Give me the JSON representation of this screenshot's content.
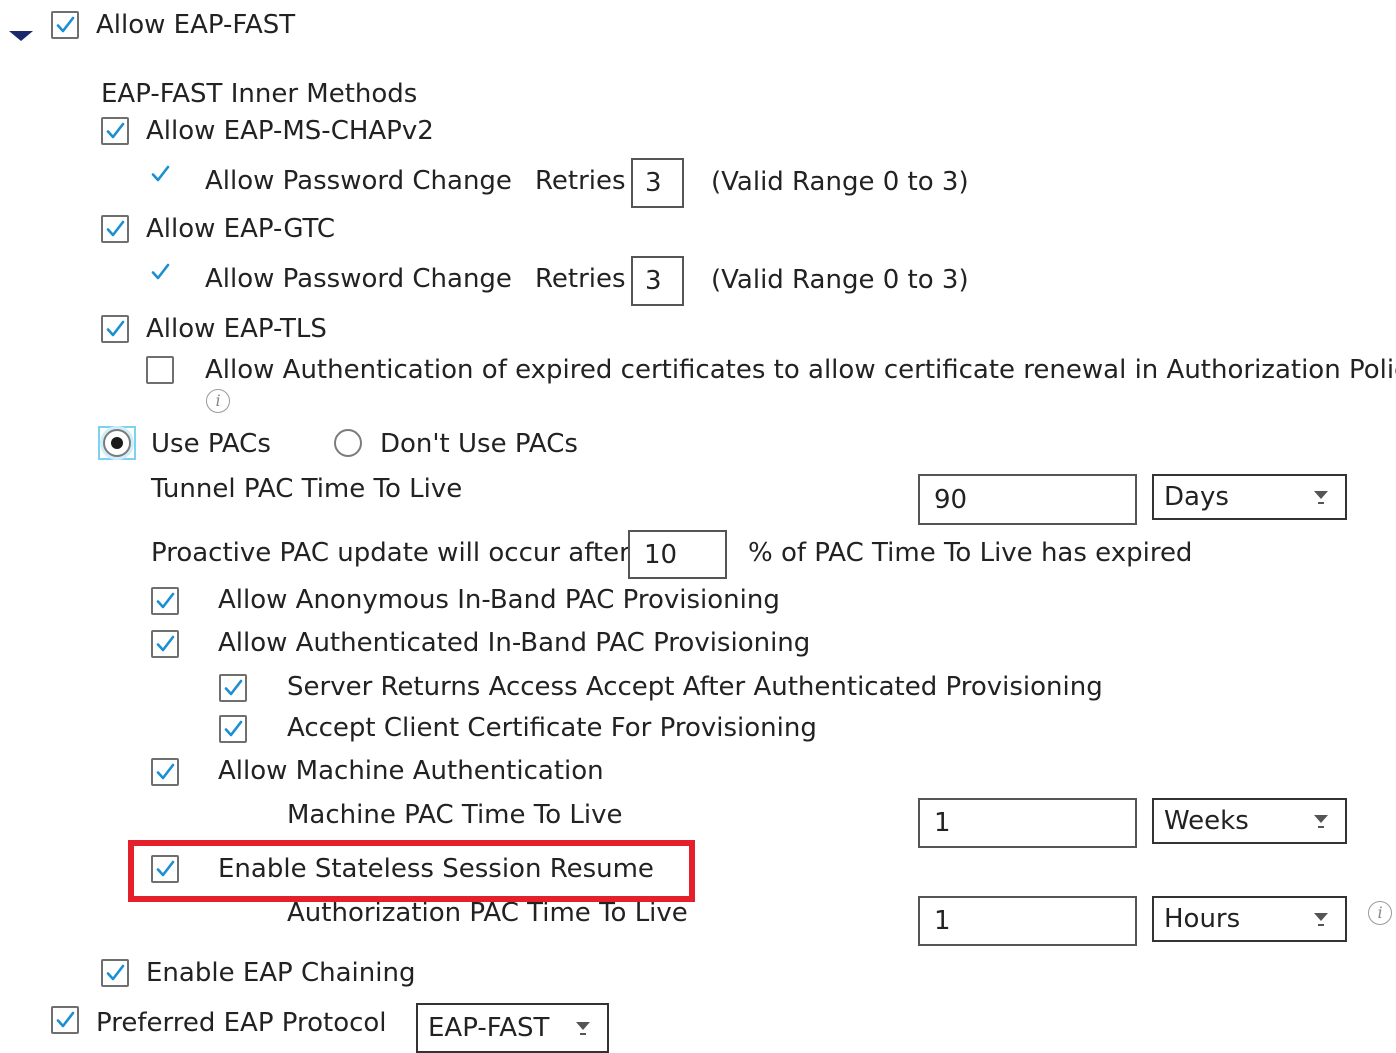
{
  "section": {
    "title": "Allow EAP-FAST",
    "checked": true
  },
  "inner_methods": {
    "heading": "EAP-FAST Inner Methods",
    "ms_chapv2": {
      "label": "Allow EAP-MS-CHAPv2",
      "password_change_label": "Allow Password Change",
      "retries_label": "Retries",
      "retries_value": "3",
      "range_text": "(Valid Range 0 to 3)"
    },
    "gtc": {
      "label": "Allow EAP-GTC",
      "password_change_label": "Allow Password Change",
      "retries_label": "Retries",
      "retries_value": "3",
      "range_text": "(Valid Range 0 to 3)"
    },
    "tls": {
      "label": "Allow EAP-TLS",
      "expired_label": "Allow Authentication of expired certificates to allow certificate renewal in Authorization Policy"
    }
  },
  "pacs": {
    "use_label": "Use PACs",
    "dont_use_label": "Don't Use PACs",
    "selected": "Use PACs",
    "tunnel_ttl_label": "Tunnel PAC Time To Live",
    "tunnel_ttl_value": "90",
    "tunnel_ttl_unit": "Days",
    "proactive_prefix": "Proactive PAC update will occur after",
    "proactive_value": "10",
    "proactive_suffix": "% of PAC Time To Live has expired",
    "anonymous_label": "Allow Anonymous In-Band PAC Provisioning",
    "authenticated_label": "Allow Authenticated In-Band PAC Provisioning",
    "server_returns_label": "Server Returns Access Accept After Authenticated Provisioning",
    "accept_client_cert_label": "Accept Client Certificate For Provisioning",
    "machine_auth_label": "Allow Machine Authentication",
    "machine_ttl_label": "Machine PAC Time To Live",
    "machine_ttl_value": "1",
    "machine_ttl_unit": "Weeks",
    "stateless_label": "Enable Stateless Session Resume",
    "authz_ttl_label": "Authorization PAC Time To Live",
    "authz_ttl_value": "1",
    "authz_ttl_unit": "Hours"
  },
  "eap_chaining": {
    "label": "Enable EAP Chaining"
  },
  "preferred": {
    "label": "Preferred EAP Protocol",
    "value": "EAP-FAST"
  },
  "icons": {
    "checkmark": "check-icon",
    "info": "info-icon",
    "expand": "caret-down-icon",
    "dropdown": "dropdown-arrow-icon"
  },
  "colors": {
    "checkmark": "#1a8fd1",
    "highlight": "#e3202b",
    "expand_caret": "#1b2a6b"
  }
}
